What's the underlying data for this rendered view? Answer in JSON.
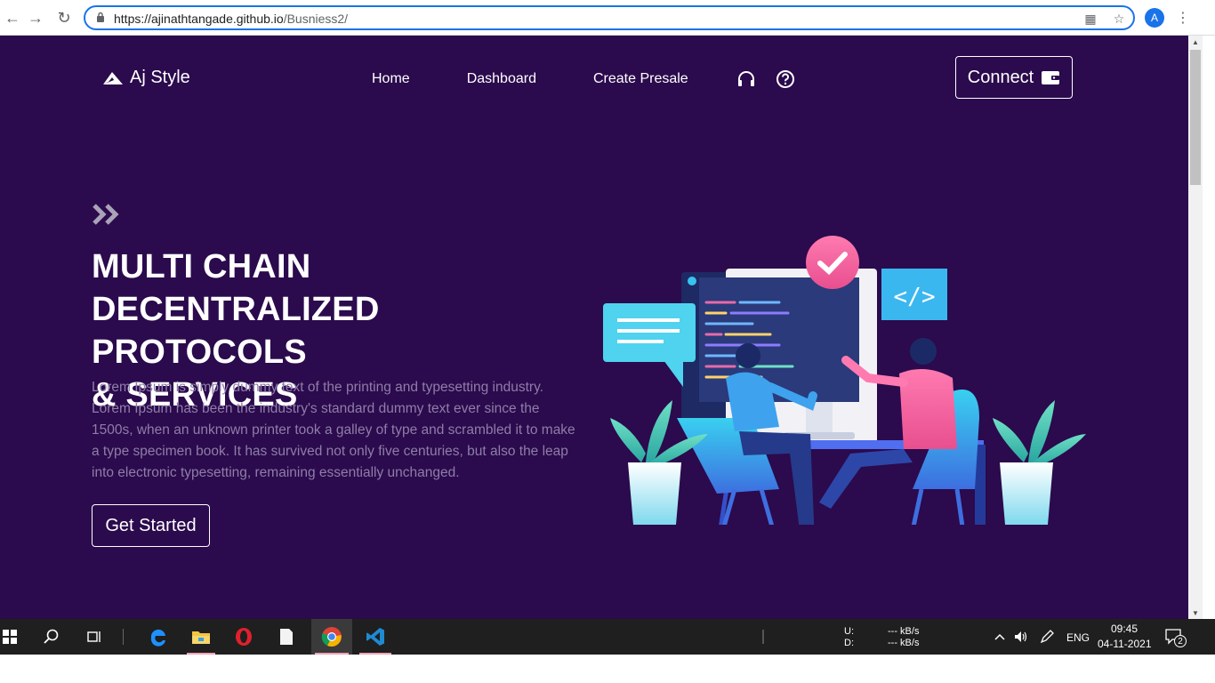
{
  "browser": {
    "url_host": "https://ajinathtangade.github.io",
    "url_path": "/Busniess2/",
    "profile_initial": "A"
  },
  "navbar": {
    "brand": "Aj Style",
    "links": [
      "Home",
      "Dashboard",
      "Create Presale"
    ],
    "connect_label": "Connect"
  },
  "hero": {
    "title_lines": [
      "MULTI CHAIN",
      "DECENTRALIZED PROTOCOLS",
      "& SERVICES"
    ],
    "description": "Lorem Ipsum is simply dummy text of the printing and typesetting industry. Lorem Ipsum has been the industry's standard dummy text ever since the 1500s, when an unknown printer took a galley of type and scrambled it to make a type specimen book. It has survived not only five centuries, but also the leap into electronic typesetting, remaining essentially unchanged.",
    "cta_label": "Get Started"
  },
  "taskbar": {
    "net_up_label": "U:",
    "net_down_label": "D:",
    "net_up_value": "--- kB/s",
    "net_down_value": "--- kB/s",
    "language": "ENG",
    "time": "09:45",
    "date": "04-11-2021",
    "notifications": "2"
  },
  "colors": {
    "page_bg": "#2b0a4d",
    "accent": "#1a73e8"
  }
}
